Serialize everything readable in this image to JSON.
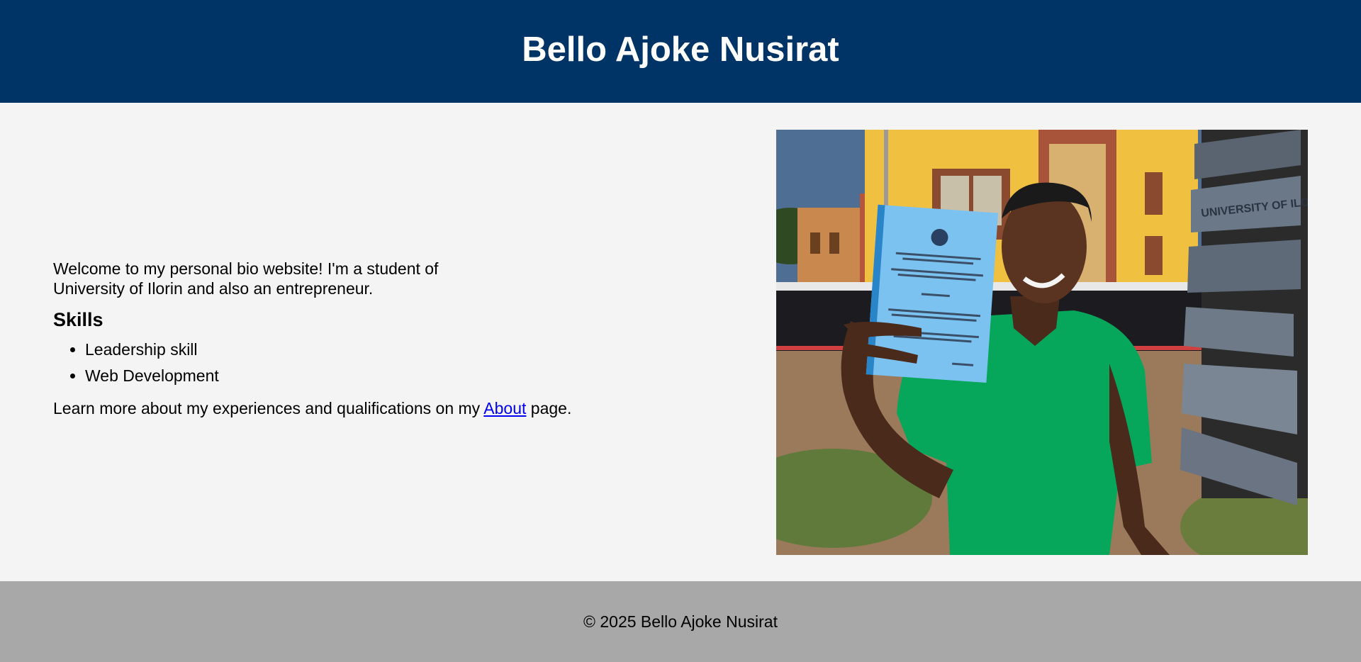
{
  "header": {
    "title": "Bello Ajoke Nusirat"
  },
  "intro": {
    "welcome": "Welcome to my personal bio website! I'm a student of University of Ilorin and also an entrepreneur.",
    "skills_heading": "Skills",
    "skills": [
      "Leadership skill",
      "Web Development"
    ],
    "more_prefix": "Learn more about my experiences and qualifications on my ",
    "more_link": "About",
    "more_suffix": " page."
  },
  "photo": {
    "sign_text": "UNIVERSITY OF ILORIN"
  },
  "footer": {
    "copyright": "© 2025 Bello Ajoke Nusirat"
  },
  "colors": {
    "header_bg": "#003366",
    "footer_bg": "#a8a8a8",
    "page_bg": "#f4f4f4",
    "link": "#0000ee"
  }
}
